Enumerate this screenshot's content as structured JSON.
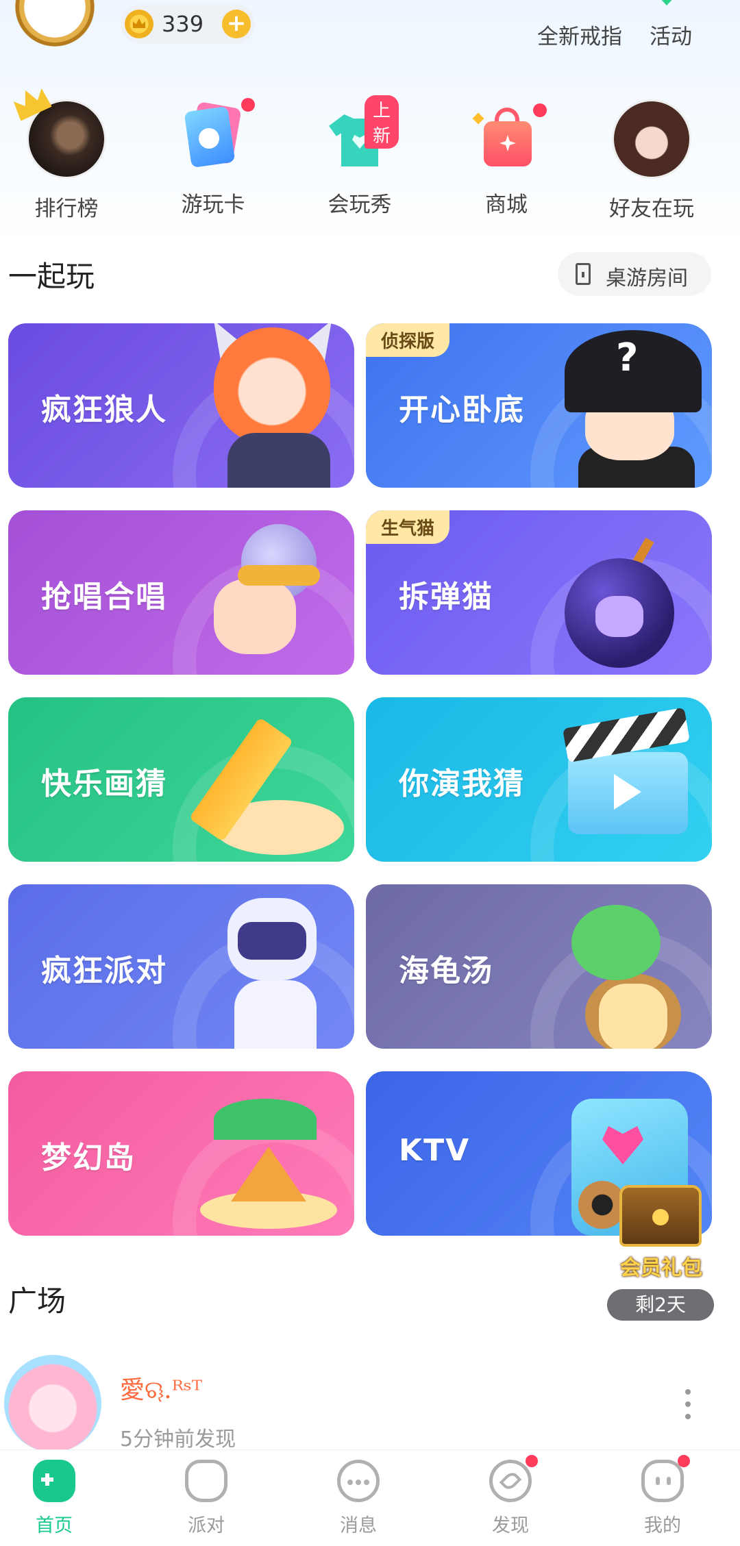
{
  "header": {
    "coin_balance": "339",
    "links": [
      "全新戒指",
      "活动"
    ]
  },
  "quick_entries": [
    {
      "label": "排行榜",
      "icon": "leaderboard-avatar-icon",
      "red_dot": false
    },
    {
      "label": "游玩卡",
      "icon": "play-card-icon",
      "red_dot": true
    },
    {
      "label": "会玩秀",
      "icon": "tshirt-icon",
      "badge": "上新"
    },
    {
      "label": "商城",
      "icon": "shopping-bag-icon",
      "red_dot": true
    },
    {
      "label": "好友在玩",
      "icon": "friend-avatar-icon",
      "red_dot": false
    }
  ],
  "play_section": {
    "title": "一起玩",
    "room_button": "桌游房间"
  },
  "games": [
    {
      "name": "疯狂狼人",
      "tag": ""
    },
    {
      "name": "开心卧底",
      "tag": "侦探版"
    },
    {
      "name": "抢唱合唱",
      "tag": ""
    },
    {
      "name": "拆弹猫",
      "tag": "生气猫"
    },
    {
      "name": "快乐画猜",
      "tag": ""
    },
    {
      "name": "你演我猜",
      "tag": ""
    },
    {
      "name": "疯狂派对",
      "tag": ""
    },
    {
      "name": "海龟汤",
      "tag": ""
    },
    {
      "name": "梦幻岛",
      "tag": ""
    },
    {
      "name": "KTV",
      "tag": ""
    }
  ],
  "vip_gift": {
    "label": "会员礼包",
    "remaining": "剩2天"
  },
  "square_section": {
    "title": "广场"
  },
  "feed": {
    "user_name": "愛ୠ.ᴿˢᵀ",
    "time": "5分钟前发现"
  },
  "bottom_nav": [
    {
      "label": "首页",
      "active": true,
      "red_dot": false
    },
    {
      "label": "派对",
      "active": false,
      "red_dot": false
    },
    {
      "label": "消息",
      "active": false,
      "red_dot": false
    },
    {
      "label": "发现",
      "active": false,
      "red_dot": true
    },
    {
      "label": "我的",
      "active": false,
      "red_dot": true
    }
  ],
  "colors": {
    "accent": "#19c98c",
    "red_dot": "#ff3b5c",
    "coin": "#f6bd2c"
  }
}
